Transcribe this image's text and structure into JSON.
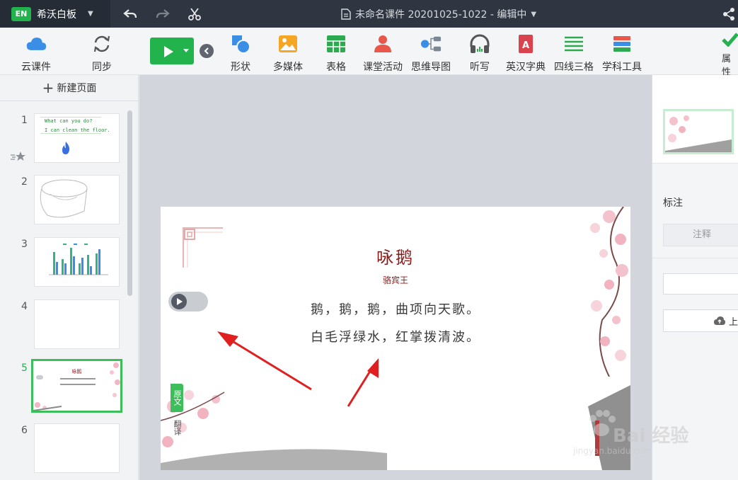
{
  "app": {
    "name": "希沃白板",
    "logo_text": "EN",
    "document_title": "未命名课件 20201025-1022 - 编辑中"
  },
  "toolbar": {
    "left_tools": [
      {
        "label": "云课件",
        "icon": "cloud-icon"
      },
      {
        "label": "同步",
        "icon": "sync-icon"
      }
    ],
    "tools": [
      {
        "label": "形状",
        "icon": "shape-icon"
      },
      {
        "label": "多媒体",
        "icon": "media-icon"
      },
      {
        "label": "表格",
        "icon": "table-icon"
      },
      {
        "label": "课堂活动",
        "icon": "classroom-activity-icon"
      },
      {
        "label": "思维导图",
        "icon": "mind-map-icon"
      },
      {
        "label": "听写",
        "icon": "headphones-icon"
      },
      {
        "label": "英汉字典",
        "icon": "dictionary-icon"
      },
      {
        "label": "四线三格",
        "icon": "four-lines-icon"
      },
      {
        "label": "学科工具",
        "icon": "subject-tools-icon"
      }
    ],
    "properties_label": "属性"
  },
  "slides_panel": {
    "new_page_label": "新建页面",
    "slides": [
      {
        "number": "1",
        "text_line1": "What can you do?",
        "text_line2": "I can clean the floor."
      },
      {
        "number": "2"
      },
      {
        "number": "3"
      },
      {
        "number": "4"
      },
      {
        "number": "5",
        "active": true,
        "mini_title": "咏鹅"
      },
      {
        "number": "6"
      }
    ]
  },
  "slide": {
    "title": "咏鹅",
    "author": "骆宾王",
    "lines": [
      "鹅，鹅，鹅，曲项向天歌。",
      "白毛浮绿水，红掌拨清波。"
    ],
    "tab_original": "原文",
    "tab_translation": "翻译"
  },
  "right_panel": {
    "annotation_label": "标注",
    "annotation_button": "注释",
    "upload_label": "上"
  },
  "watermark": {
    "text": "Bai  经验",
    "url": "jingyan.baidu.com"
  },
  "colors": {
    "brand_green": "#22b34c",
    "titlebar": "#2f3641",
    "poem_red": "#8b1a1a",
    "arrow_red": "#e02020"
  }
}
